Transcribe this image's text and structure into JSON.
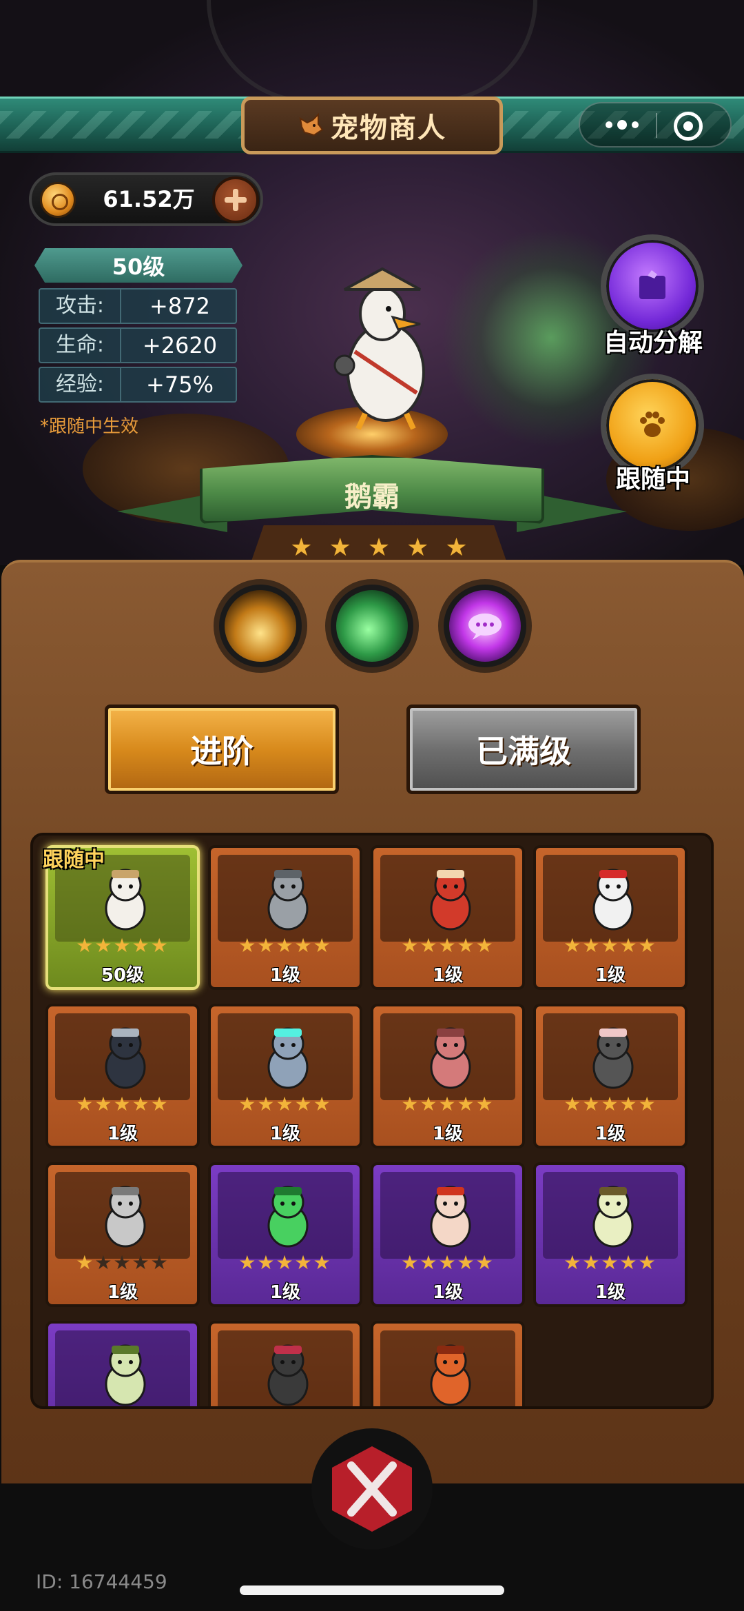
{
  "header": {
    "title": "宠物商人",
    "fox_icon": "fox-icon",
    "menu_icon": "more-dots-icon",
    "close_icon": "target-icon"
  },
  "currency": {
    "amount": "61.52万",
    "icon": "coin-icon",
    "add_icon": "plus-icon"
  },
  "stats": {
    "level": "50级",
    "rows": [
      {
        "label": "攻击:",
        "value": "+872"
      },
      {
        "label": "生命:",
        "value": "+2620"
      },
      {
        "label": "经验:",
        "value": "+75%"
      }
    ],
    "note": "*跟随中生效"
  },
  "side_buttons": {
    "auto_decompose": "自动分解",
    "following": "跟随中"
  },
  "pet": {
    "name": "鹅霸",
    "stars": 5
  },
  "skills": [
    "skill-lightning-icon",
    "skill-claw-icon",
    "skill-speech-icon"
  ],
  "actions": {
    "advance": "进阶",
    "maxed": "已满级"
  },
  "grid": {
    "following_tag": "跟随中",
    "cards": [
      {
        "level": "50级",
        "stars": 5,
        "rarity": "active",
        "pet": "goose"
      },
      {
        "level": "1级",
        "stars": 5,
        "rarity": "orange",
        "pet": "knight"
      },
      {
        "level": "1级",
        "stars": 5,
        "rarity": "orange",
        "pet": "daruma"
      },
      {
        "level": "1级",
        "stars": 5,
        "rarity": "orange",
        "pet": "clown"
      },
      {
        "level": "1级",
        "stars": 5,
        "rarity": "orange",
        "pet": "plague-crow"
      },
      {
        "level": "1级",
        "stars": 5,
        "rarity": "orange",
        "pet": "spider-robot"
      },
      {
        "level": "1级",
        "stars": 5,
        "rarity": "orange",
        "pet": "zombie-bear"
      },
      {
        "level": "1级",
        "stars": 5,
        "rarity": "orange",
        "pet": "masked-doll"
      },
      {
        "level": "1级",
        "stars": 1,
        "rarity": "orange",
        "pet": "armor-glove"
      },
      {
        "level": "1级",
        "stars": 5,
        "rarity": "purple",
        "pet": "green-frog"
      },
      {
        "level": "1级",
        "stars": 5,
        "rarity": "purple",
        "pet": "chicken"
      },
      {
        "level": "1级",
        "stars": 5,
        "rarity": "purple",
        "pet": "egg-creature"
      },
      {
        "level": "",
        "stars": 0,
        "rarity": "purple",
        "pet": "horned-skull"
      },
      {
        "level": "",
        "stars": 0,
        "rarity": "orange",
        "pet": "toothy-monster"
      },
      {
        "level": "",
        "stars": 0,
        "rarity": "orange",
        "pet": "fire-dragon"
      }
    ]
  },
  "footer": {
    "user_id": "ID: 16744459"
  }
}
